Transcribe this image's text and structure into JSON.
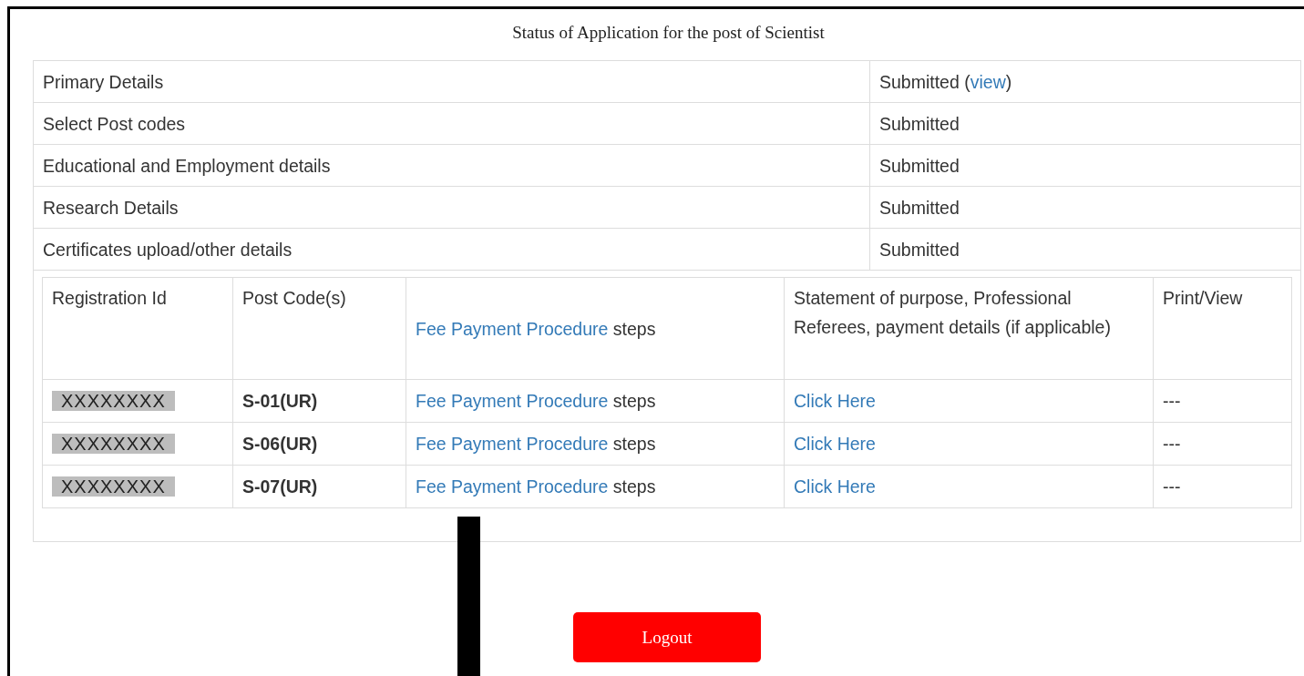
{
  "title": "Status of Application for the post of Scientist",
  "sections": [
    {
      "name": "Primary Details",
      "status": [
        {
          "kind": "text",
          "text": "Submitted ("
        },
        {
          "kind": "link",
          "text": "view"
        },
        {
          "kind": "text",
          "text": ")"
        }
      ]
    },
    {
      "name": "Select Post codes",
      "status": [
        {
          "kind": "text",
          "text": "Submitted"
        }
      ]
    },
    {
      "name": "Educational and Employment details",
      "status": [
        {
          "kind": "text",
          "text": "Submitted"
        }
      ]
    },
    {
      "name": "Research Details",
      "status": [
        {
          "kind": "text",
          "text": "Submitted"
        }
      ]
    },
    {
      "name": "Certificates upload/other details",
      "status": [
        {
          "kind": "text",
          "text": "Submitted"
        }
      ]
    }
  ],
  "applications": {
    "columns": [
      [
        {
          "kind": "text",
          "text": "Registration Id"
        }
      ],
      [
        {
          "kind": "text",
          "text": "Post Code(s)"
        }
      ],
      [
        {
          "kind": "link",
          "text": "Fee Payment Procedure"
        },
        {
          "kind": "text",
          "text": " steps"
        }
      ],
      [
        {
          "kind": "text",
          "text": "Statement of purpose, Professional Referees, payment details (if applicable)"
        }
      ],
      [
        {
          "kind": "text",
          "text": "Print/View"
        }
      ]
    ],
    "rows": [
      {
        "registration_id": "XXXXXXXX",
        "post_code": "S-01(UR)",
        "fee": [
          {
            "kind": "link",
            "text": "Fee Payment Procedure"
          },
          {
            "kind": "text",
            "text": " steps"
          }
        ],
        "statement": "Click Here",
        "print_view": "---"
      },
      {
        "registration_id": "XXXXXXXX",
        "post_code": "S-06(UR)",
        "fee": [
          {
            "kind": "link",
            "text": "Fee Payment Procedure"
          },
          {
            "kind": "text",
            "text": " steps"
          }
        ],
        "statement": "Click Here",
        "print_view": "---"
      },
      {
        "registration_id": "XXXXXXXX",
        "post_code": "S-07(UR)",
        "fee": [
          {
            "kind": "link",
            "text": "Fee Payment Procedure"
          },
          {
            "kind": "text",
            "text": " steps"
          }
        ],
        "statement": "Click Here",
        "print_view": "---"
      }
    ]
  },
  "logout": "Logout"
}
